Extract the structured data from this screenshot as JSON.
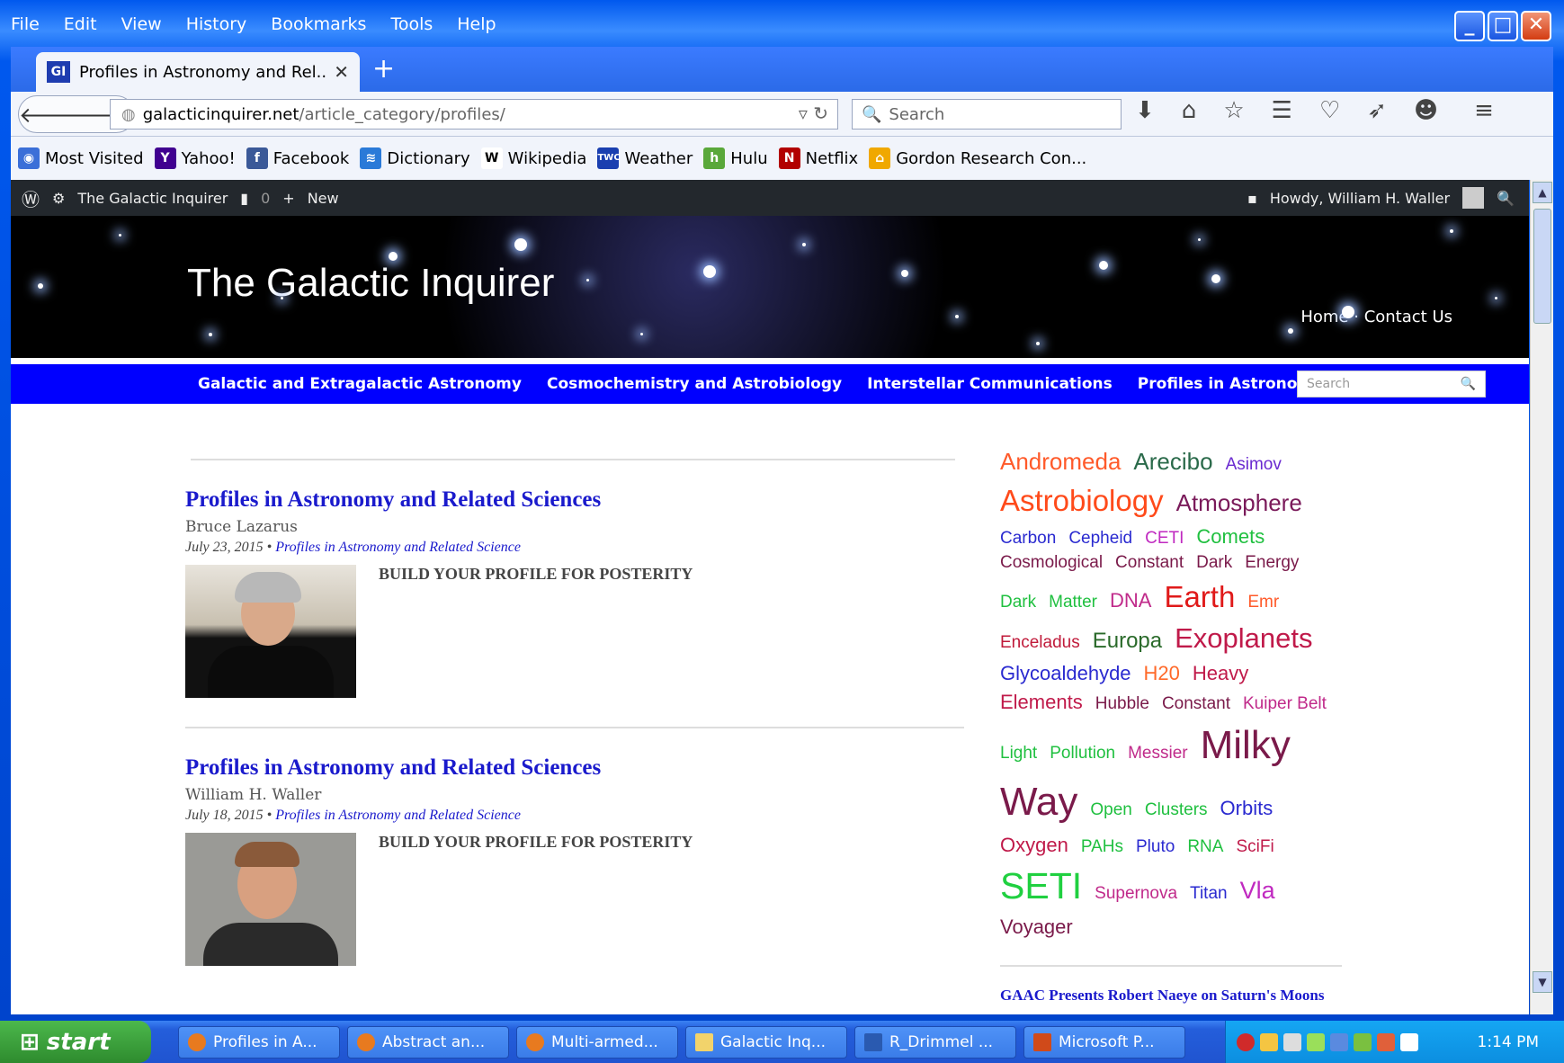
{
  "menubar": [
    "File",
    "Edit",
    "View",
    "History",
    "Bookmarks",
    "Tools",
    "Help"
  ],
  "tab": {
    "favicon": "GI",
    "title": "Profiles in Astronomy and Rel..."
  },
  "url": {
    "domain": "galacticinquirer.net",
    "path": "/article_category/profiles/"
  },
  "search_placeholder": "Search",
  "bookmarks": [
    {
      "label": "Most Visited",
      "color": "#3b6fd8",
      "glyph": "◉"
    },
    {
      "label": "Yahoo!",
      "color": "#400090",
      "glyph": "Y"
    },
    {
      "label": "Facebook",
      "color": "#3b5998",
      "glyph": "f"
    },
    {
      "label": "Dictionary",
      "color": "#2a7ad8",
      "glyph": "≋"
    },
    {
      "label": "Wikipedia",
      "color": "#fff",
      "glyph": "W"
    },
    {
      "label": "Weather",
      "color": "#1a3fb0",
      "glyph": "TWC"
    },
    {
      "label": "Hulu",
      "color": "#5aa83a",
      "glyph": "h"
    },
    {
      "label": "Netflix",
      "color": "#b20000",
      "glyph": "N"
    },
    {
      "label": "Gordon Research Con...",
      "color": "#f0a800",
      "glyph": "⌂"
    }
  ],
  "wpbar": {
    "site": "The Galactic Inquirer",
    "comments": "0",
    "new": "New",
    "howdy": "Howdy, William H. Waller"
  },
  "site": {
    "title": "The Galactic Inquirer",
    "nav_home": "Home",
    "nav_contact": "Contact Us"
  },
  "catnav": [
    "Galactic and Extragalactic Astronomy",
    "Cosmochemistry and Astrobiology",
    "Interstellar Communications",
    "Profiles in Astronomy"
  ],
  "catsearch": "Search",
  "articles": [
    {
      "title": "Profiles in Astronomy and Related Sciences",
      "author": "Bruce Lazarus",
      "date": "July 23, 2015",
      "category": "Profiles in Astronomy and Related Science",
      "excerpt": "BUILD YOUR PROFILE FOR POSTERITY"
    },
    {
      "title": "Profiles in Astronomy and Related Sciences",
      "author": "William H. Waller",
      "date": "July 18, 2015",
      "category": "Profiles in Astronomy and Related Science",
      "excerpt": "BUILD YOUR PROFILE FOR POSTERITY"
    }
  ],
  "tagcloud": [
    {
      "t": "Andromeda",
      "c": "#ff5a2a",
      "s": 26
    },
    {
      "t": "Arecibo",
      "c": "#2a6a4a",
      "s": 26
    },
    {
      "t": "Asimov",
      "c": "#6a2ad0",
      "s": 19
    },
    {
      "t": "Astrobiology",
      "c": "#ff4a1a",
      "s": 33
    },
    {
      "t": "Atmosphere",
      "c": "#7a1a5a",
      "s": 26
    },
    {
      "t": "Carbon",
      "c": "#2a2ad0",
      "s": 19
    },
    {
      "t": "Cepheid",
      "c": "#2a2ad0",
      "s": 19
    },
    {
      "t": "CETI",
      "c": "#c02ac0",
      "s": 19
    },
    {
      "t": "Comets",
      "c": "#20c040",
      "s": 22
    },
    {
      "t": "Cosmological",
      "c": "#7a1a4a",
      "s": 19
    },
    {
      "t": "Constant",
      "c": "#7a1a4a",
      "s": 19
    },
    {
      "t": "Dark",
      "c": "#7a1a4a",
      "s": 19
    },
    {
      "t": "Energy",
      "c": "#7a1a4a",
      "s": 19
    },
    {
      "t": "Dark",
      "c": "#20c040",
      "s": 19
    },
    {
      "t": "Matter",
      "c": "#20c040",
      "s": 19
    },
    {
      "t": "DNA",
      "c": "#c02a8a",
      "s": 22
    },
    {
      "t": "Earth",
      "c": "#e01a1a",
      "s": 33
    },
    {
      "t": "Emr",
      "c": "#ff5a2a",
      "s": 19
    },
    {
      "t": "Enceladus",
      "c": "#c01a3a",
      "s": 19
    },
    {
      "t": "Europa",
      "c": "#2a6a2a",
      "s": 24
    },
    {
      "t": "Exoplanets",
      "c": "#c01a4a",
      "s": 31
    },
    {
      "t": "Glycoaldehyde",
      "c": "#2a2ad0",
      "s": 22
    },
    {
      "t": "H20",
      "c": "#ff6a2a",
      "s": 22
    },
    {
      "t": "Heavy",
      "c": "#c01a4a",
      "s": 22
    },
    {
      "t": "Elements",
      "c": "#c01a4a",
      "s": 22
    },
    {
      "t": "Hubble",
      "c": "#7a1a4a",
      "s": 19
    },
    {
      "t": "Constant",
      "c": "#7a1a4a",
      "s": 19
    },
    {
      "t": "Kuiper Belt",
      "c": "#c02a8a",
      "s": 19
    },
    {
      "t": "Light",
      "c": "#20c040",
      "s": 19
    },
    {
      "t": "Pollution",
      "c": "#20c040",
      "s": 19
    },
    {
      "t": "Messier",
      "c": "#c02a8a",
      "s": 19
    },
    {
      "t": "Milky",
      "c": "#7a1a4a",
      "s": 44
    },
    {
      "t": "Way",
      "c": "#7a1a4a",
      "s": 44
    },
    {
      "t": "Open",
      "c": "#20c040",
      "s": 19
    },
    {
      "t": "Clusters",
      "c": "#20c040",
      "s": 19
    },
    {
      "t": "Orbits",
      "c": "#2a2ad0",
      "s": 22
    },
    {
      "t": "Oxygen",
      "c": "#c01a4a",
      "s": 22
    },
    {
      "t": "PAHs",
      "c": "#20c040",
      "s": 19
    },
    {
      "t": "Pluto",
      "c": "#2a2ad0",
      "s": 19
    },
    {
      "t": "RNA",
      "c": "#20c040",
      "s": 19
    },
    {
      "t": "SciFi",
      "c": "#c01a4a",
      "s": 19
    },
    {
      "t": "SETI",
      "c": "#20d040",
      "s": 41
    },
    {
      "t": "Supernova",
      "c": "#c02a8a",
      "s": 19
    },
    {
      "t": "Titan",
      "c": "#2a2ad0",
      "s": 19
    },
    {
      "t": "Vla",
      "c": "#c02ac0",
      "s": 27
    },
    {
      "t": "Voyager",
      "c": "#7a1a4a",
      "s": 22
    }
  ],
  "sidepost": "GAAC Presents Robert Naeye on Saturn's Moons",
  "taskbar": {
    "start": "start",
    "items": [
      "Profiles in A...",
      "Abstract an...",
      "Multi-armed...",
      "Galactic Inq...",
      "R_Drimmel ...",
      "Microsoft P..."
    ],
    "clock": "1:14 PM"
  }
}
